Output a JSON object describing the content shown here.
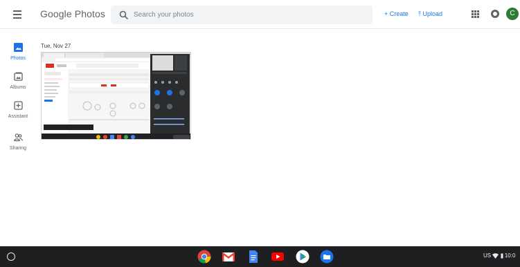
{
  "header": {
    "logo_google": "Google",
    "logo_photos": "Photos",
    "search_placeholder": "Search your photos",
    "create_label": "Create",
    "upload_label": "Upload",
    "avatar_letter": "C"
  },
  "nav": {
    "items": [
      {
        "label": "Photos",
        "icon": "photos-icon"
      },
      {
        "label": "Albums",
        "icon": "albums-icon"
      },
      {
        "label": "Assistant",
        "icon": "assistant-icon"
      },
      {
        "label": "Sharing",
        "icon": "sharing-icon"
      }
    ]
  },
  "content": {
    "date_heading": "Tue, Nov 27"
  },
  "shelf": {
    "apps": [
      "chrome-icon",
      "gmail-icon",
      "docs-icon",
      "youtube-icon",
      "play-store-icon",
      "files-icon"
    ],
    "locale": "US",
    "time": "10:0"
  },
  "colors": {
    "accent": "#1a73e8",
    "avatar_bg": "#2e7d32",
    "shelf_bg": "#1e1f20"
  }
}
